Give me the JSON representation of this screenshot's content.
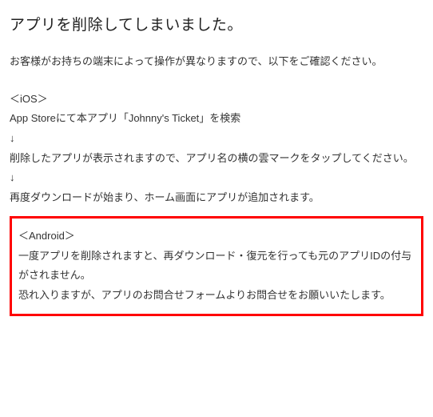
{
  "title": "アプリを削除してしまいました。",
  "intro": "お客様がお持ちの端末によって操作が異なりますので、以下をご確認ください。",
  "ios": {
    "header": "＜iOS＞",
    "line1": "App Storeにて本アプリ「Johnny's Ticket」を検索",
    "arrow1": "↓",
    "line2": "削除したアプリが表示されますので、アプリ名の横の雲マークをタップしてください。",
    "arrow2": "↓",
    "line3": "再度ダウンロードが始まり、ホーム画面にアプリが追加されます。"
  },
  "android": {
    "header": "＜Android＞",
    "line1": "一度アプリを削除されますと、再ダウンロード・復元を行っても元のアプリIDの付与がされません。",
    "line2": "恐れ入りますが、アプリのお問合せフォームよりお問合せをお願いいたします。"
  }
}
